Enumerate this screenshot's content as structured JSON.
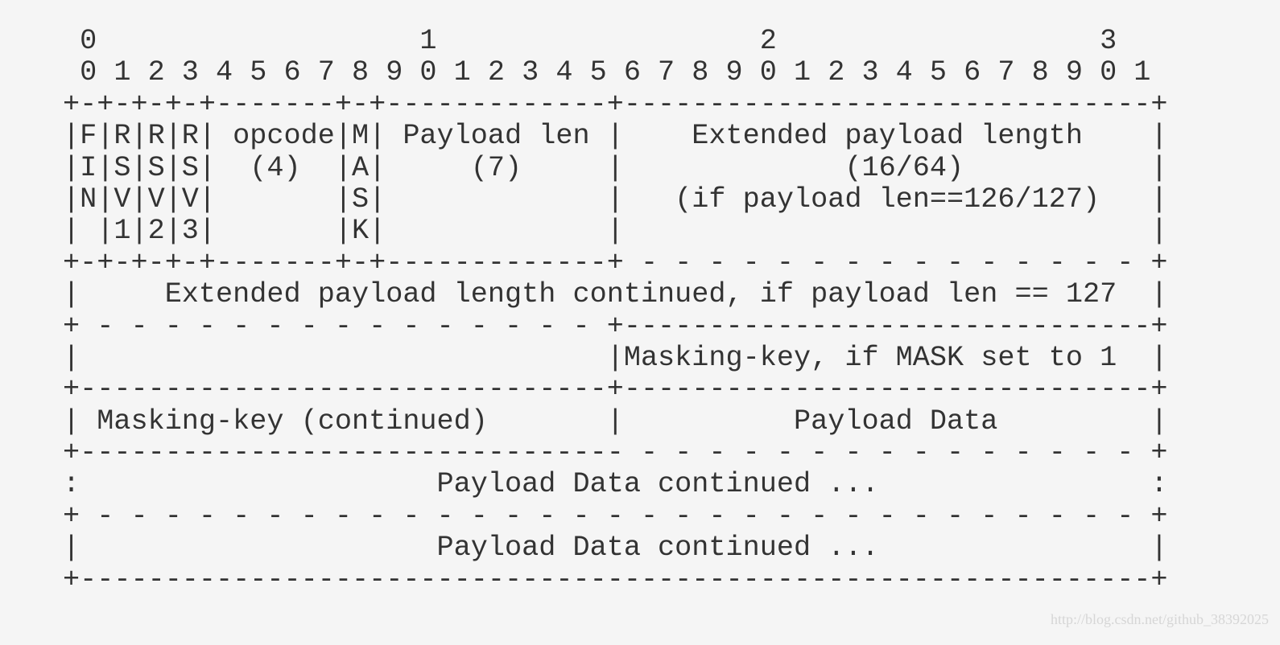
{
  "diagram": {
    "lines": [
      " 0                   1                   2                   3",
      " 0 1 2 3 4 5 6 7 8 9 0 1 2 3 4 5 6 7 8 9 0 1 2 3 4 5 6 7 8 9 0 1",
      "+-+-+-+-+-------+-+-------------+-------------------------------+",
      "|F|R|R|R| opcode|M| Payload len |    Extended payload length    |",
      "|I|S|S|S|  (4)  |A|     (7)     |             (16/64)           |",
      "|N|V|V|V|       |S|             |   (if payload len==126/127)   |",
      "| |1|2|3|       |K|             |                               |",
      "+-+-+-+-+-------+-+-------------+ - - - - - - - - - - - - - - - +",
      "|     Extended payload length continued, if payload len == 127  |",
      "+ - - - - - - - - - - - - - - - +-------------------------------+",
      "|                               |Masking-key, if MASK set to 1  |",
      "+-------------------------------+-------------------------------+",
      "| Masking-key (continued)       |          Payload Data         |",
      "+-------------------------------- - - - - - - - - - - - - - - - +",
      ":                     Payload Data continued ...                :",
      "+ - - - - - - - - - - - - - - - - - - - - - - - - - - - - - - - +",
      "|                     Payload Data continued ...                |",
      "+---------------------------------------------------------------+"
    ]
  },
  "watermark": "http://blog.csdn.net/github_38392025"
}
